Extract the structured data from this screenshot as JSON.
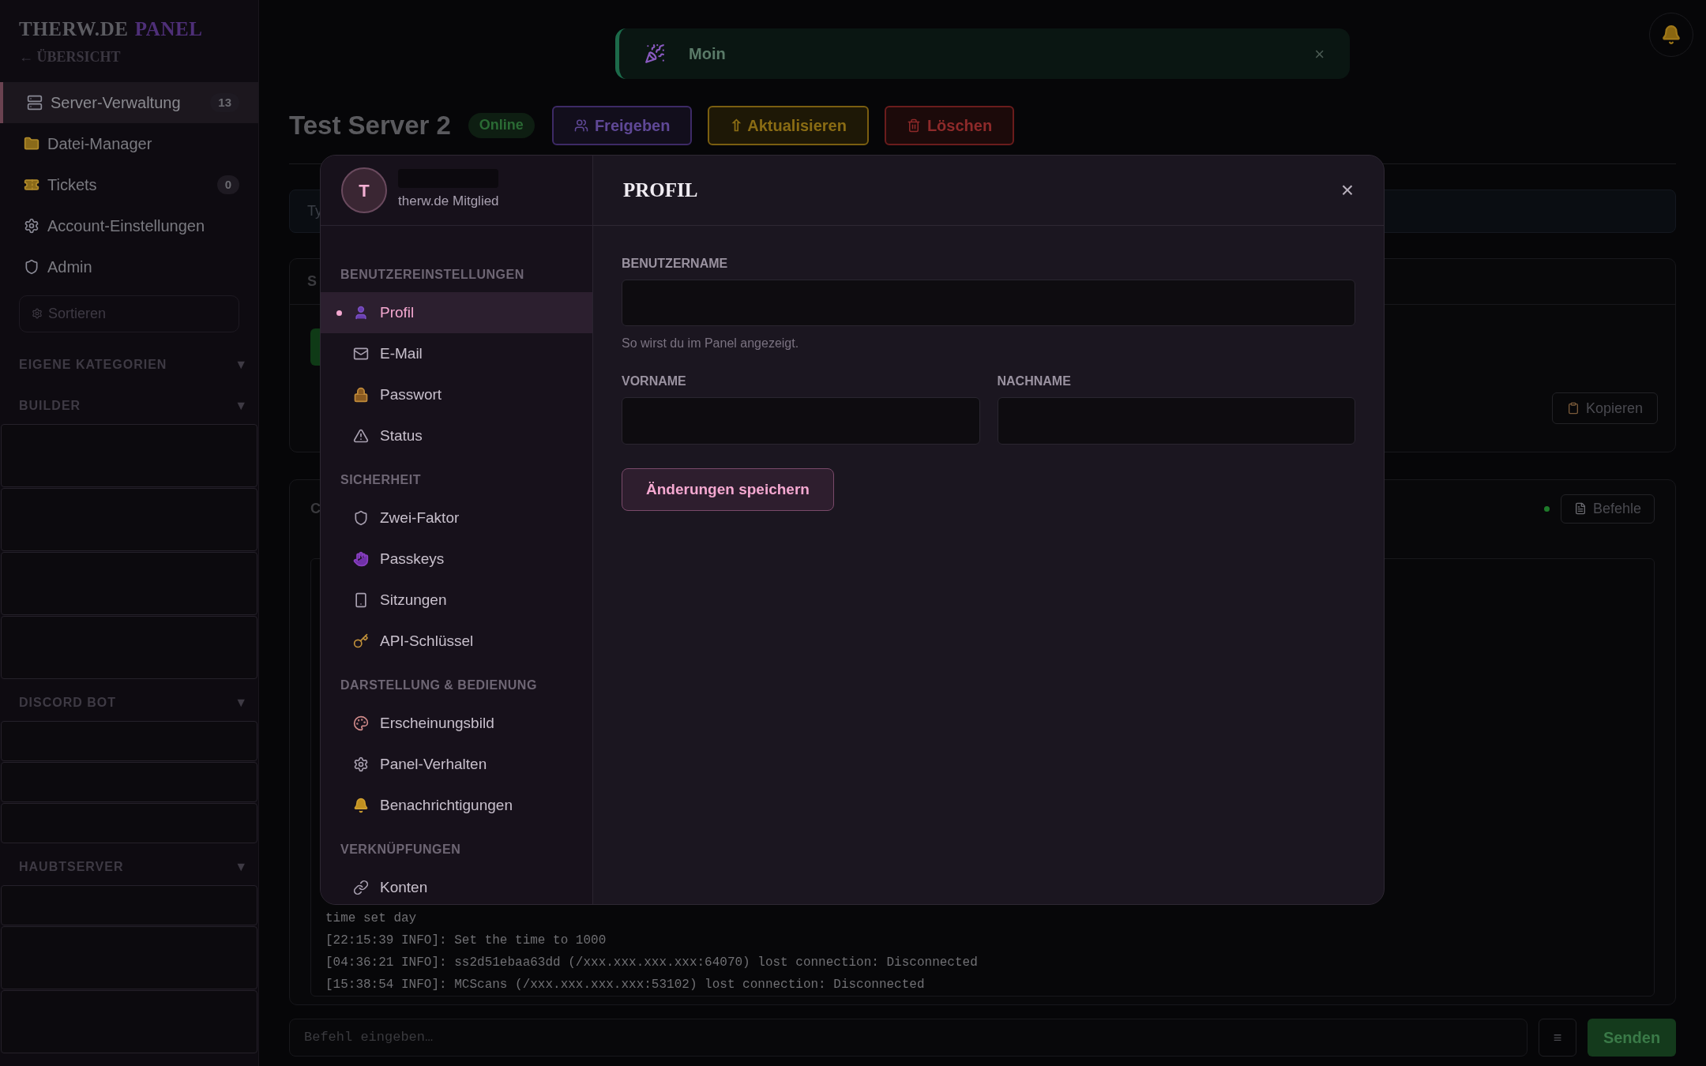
{
  "sidebar": {
    "brand": {
      "first": "THERW.DE",
      "second": "PANEL"
    },
    "back_link": "← ÜBERSICHT",
    "nav": [
      {
        "label": "Server-Verwaltung",
        "badge": "13",
        "selected": true
      },
      {
        "label": "Datei-Manager",
        "selected": false
      },
      {
        "label": "Tickets",
        "badge": "0",
        "selected": false
      },
      {
        "label": "Account-Einstellungen",
        "selected": false
      },
      {
        "label": "Admin",
        "selected": false
      }
    ],
    "sort_field": {
      "placeholder": "Sortieren"
    },
    "categories": [
      {
        "title": "EIGENE KATEGORIEN",
        "toggle": "▼"
      },
      {
        "title": "BUILDER",
        "toggle": "▼",
        "cards": [
          {
            "kind": "tall"
          },
          {
            "kind": "tall"
          },
          {
            "kind": "tall"
          },
          {
            "kind": "tall"
          }
        ]
      },
      {
        "title": "DISCORD BOT",
        "toggle": "▼",
        "cards": [
          {
            "kind": "short"
          },
          {
            "kind": "short"
          },
          {
            "kind": "short"
          }
        ]
      },
      {
        "title": "HAUBTSERVER",
        "toggle": "▼",
        "cards": [
          {
            "kind": "short"
          },
          {
            "kind": "tall"
          },
          {
            "kind": "tall"
          }
        ]
      }
    ]
  },
  "toast": {
    "message": "Moin",
    "close": "×"
  },
  "server": {
    "title": "Test Server 2",
    "status": "Online",
    "actions": [
      {
        "label": "Freigeben",
        "kind": "share"
      },
      {
        "label": "⇧ Aktualisieren",
        "kind": "update"
      },
      {
        "label": "Löschen",
        "kind": "delete"
      }
    ]
  },
  "background": {
    "field_text": "Ty",
    "card_title": "S",
    "copy_button": "Kopieren",
    "console_title": "C",
    "commands_button": "Befehle"
  },
  "console": {
    "lines": [
      "time set day",
      "[22:15:39 INFO]: Set the time to 1000",
      "[04:36:21 INFO]: ss2d51ebaa63dd (/xxx.xxx.xxx.xxx:64070) lost connection: Disconnected",
      "[15:38:54 INFO]: MCScans (/xxx.xxx.xxx.xxx:53102) lost connection: Disconnected"
    ],
    "input_placeholder": "Befehl eingeben…",
    "menu": "≡",
    "send": "Senden"
  },
  "modal": {
    "user": {
      "avatar": "T",
      "role": "therw.de Mitglied"
    },
    "sections": [
      {
        "title": "BENUTZEREINSTELLUNGEN",
        "items": [
          {
            "label": "Profil",
            "selected": true
          },
          {
            "label": "E-Mail",
            "selected": false
          },
          {
            "label": "Passwort",
            "selected": false
          },
          {
            "label": "Status",
            "selected": false
          }
        ]
      },
      {
        "title": "SICHERHEIT",
        "items": [
          {
            "label": "Zwei-Faktor",
            "selected": false
          },
          {
            "label": "Passkeys",
            "selected": false
          },
          {
            "label": "Sitzungen",
            "selected": false
          },
          {
            "label": "API-Schlüssel",
            "selected": false
          }
        ]
      },
      {
        "title": "DARSTELLUNG & BEDIENUNG",
        "items": [
          {
            "label": "Erscheinungsbild",
            "selected": false
          },
          {
            "label": "Panel-Verhalten",
            "selected": false
          },
          {
            "label": "Benachrichtigungen",
            "selected": false
          }
        ]
      },
      {
        "title": "VERKNÜPFUNGEN",
        "items": [
          {
            "label": "Konten",
            "selected": false
          }
        ]
      }
    ],
    "title": "PROFIL",
    "close": "×",
    "form": {
      "username": {
        "label": "BENUTZERNAME",
        "hint": "So wirst du im Panel angezeigt."
      },
      "first_name": {
        "label": "VORNAME"
      },
      "last_name": {
        "label": "NACHNAME"
      },
      "save": "Änderungen speichern"
    }
  }
}
